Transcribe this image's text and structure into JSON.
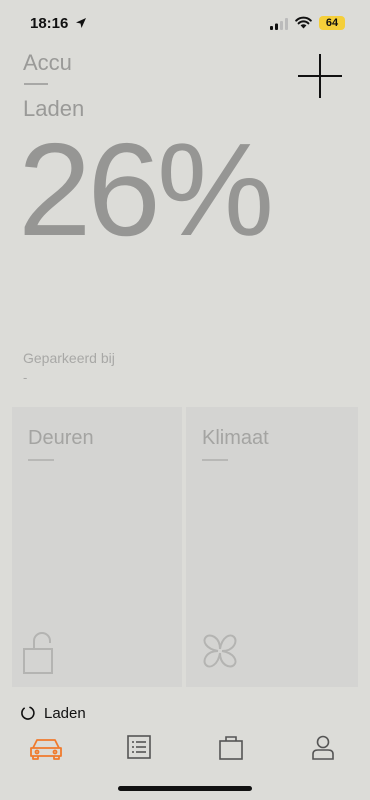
{
  "status_bar": {
    "time": "18:16",
    "battery_level": "64",
    "battery_color": "#f5cf3a",
    "icons": [
      "location-arrow-icon",
      "signal-icon",
      "wifi-icon"
    ]
  },
  "header": {
    "title": "Accu",
    "subtitle": "Laden",
    "add_icon": "plus-icon"
  },
  "battery": {
    "percent_text": "26%"
  },
  "parked": {
    "label": "Geparkeerd bij",
    "value": "-"
  },
  "tiles": [
    {
      "title": "Deuren",
      "icon": "lock-icon"
    },
    {
      "title": "Klimaat",
      "icon": "fan-icon"
    }
  ],
  "loading": {
    "text": "Laden",
    "icon": "spinner-icon"
  },
  "tab_bar": {
    "accent_color": "#f07a2c",
    "tabs": [
      {
        "icon": "car-icon",
        "active": true
      },
      {
        "icon": "list-icon",
        "active": false
      },
      {
        "icon": "shop-bag-icon",
        "active": false
      },
      {
        "icon": "profile-icon",
        "active": false
      }
    ]
  }
}
